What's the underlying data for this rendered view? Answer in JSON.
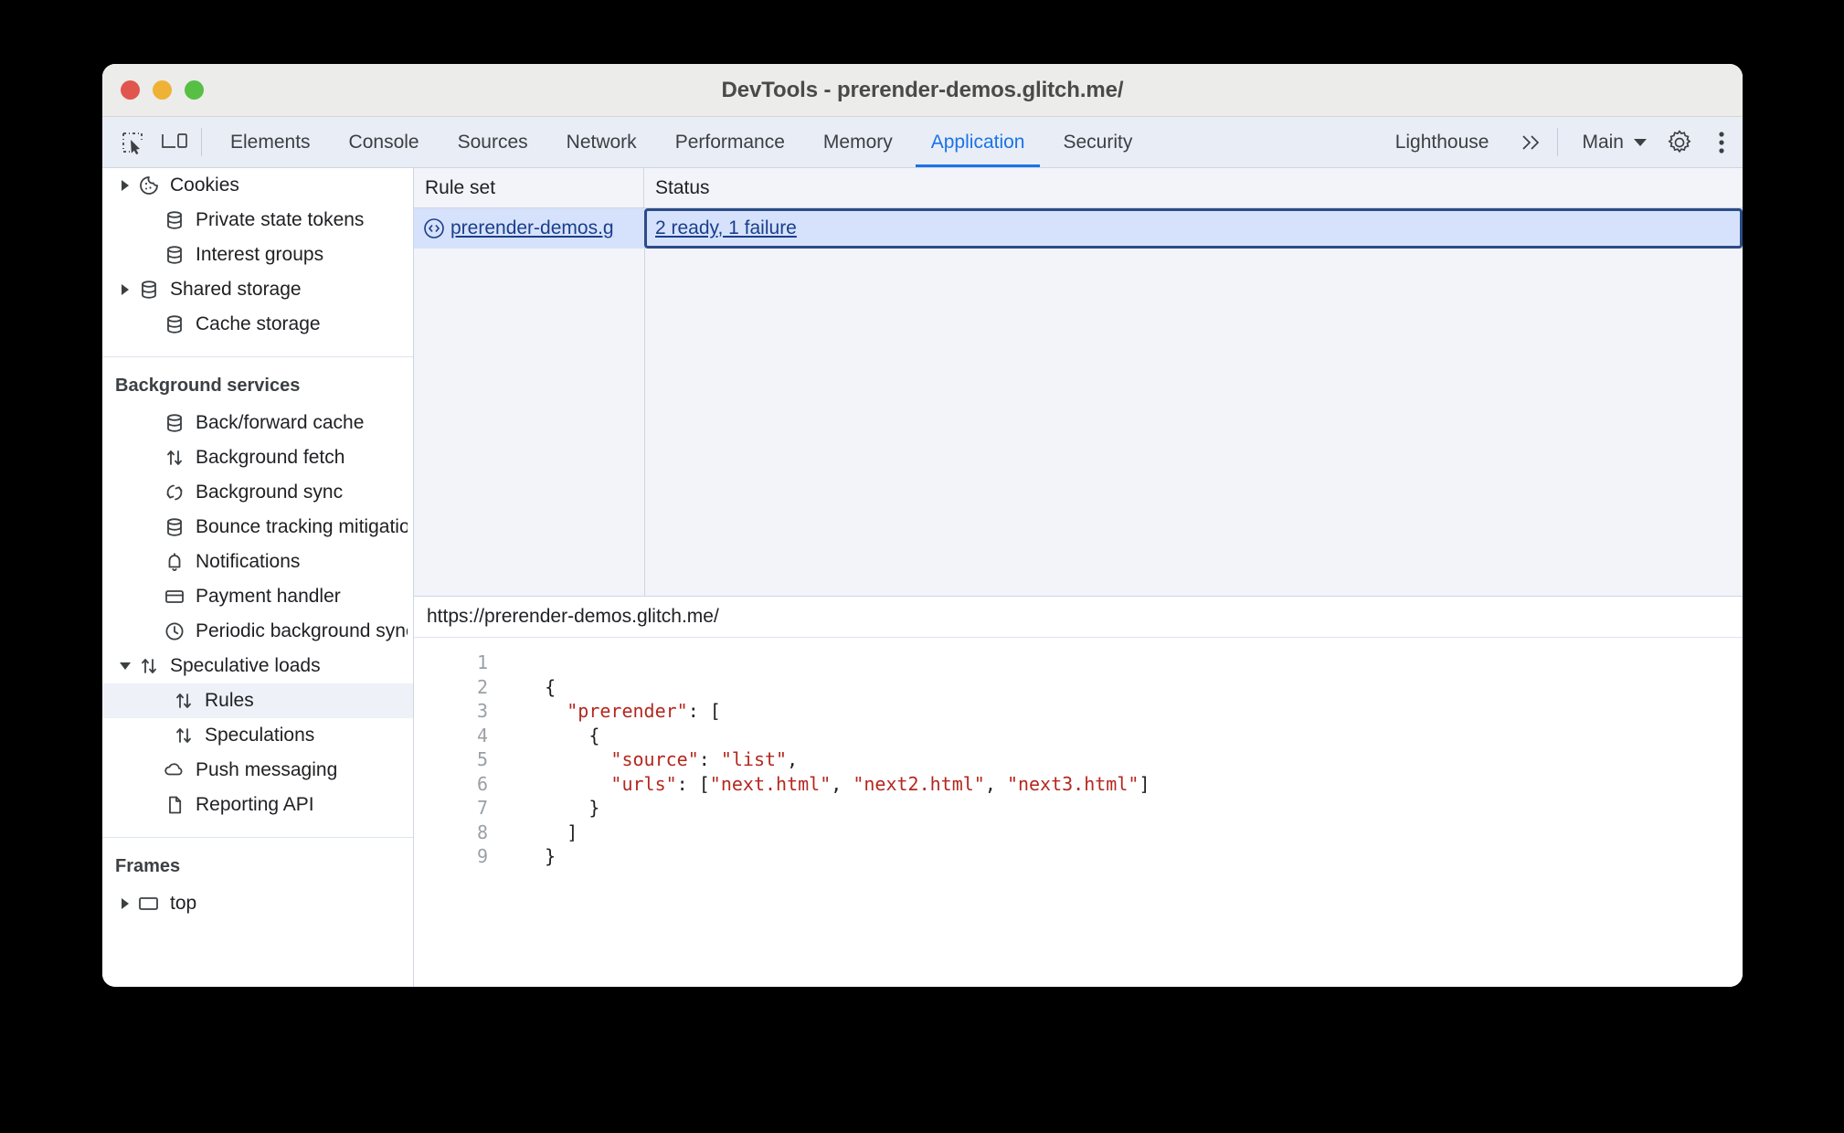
{
  "window": {
    "title": "DevTools - prerender-demos.glitch.me/",
    "traffic_lights": [
      "close",
      "minimize",
      "zoom"
    ]
  },
  "toolbar": {
    "inspect_icon": "inspect-element-icon",
    "device_icon": "device-toolbar-icon",
    "tabs": [
      {
        "label": "Elements",
        "active": false
      },
      {
        "label": "Console",
        "active": false
      },
      {
        "label": "Sources",
        "active": false
      },
      {
        "label": "Network",
        "active": false
      },
      {
        "label": "Performance",
        "active": false
      },
      {
        "label": "Memory",
        "active": false
      },
      {
        "label": "Application",
        "active": true
      },
      {
        "label": "Security",
        "active": false
      },
      {
        "label": "Lighthouse",
        "active": false
      }
    ],
    "more_tabs_label": "≫",
    "context_label": "Main",
    "settings_icon": "gear-icon",
    "more_icon": "kebab-menu-icon",
    "accent_color": "#1a73e8"
  },
  "sidebar": {
    "storage_items": [
      {
        "label": "Cookies",
        "icon": "cookie-icon",
        "arrow": true,
        "indent": 0,
        "selected": false
      },
      {
        "label": "Private state tokens",
        "icon": "database-icon",
        "arrow": false,
        "indent": 1,
        "selected": false
      },
      {
        "label": "Interest groups",
        "icon": "database-icon",
        "arrow": false,
        "indent": 1,
        "selected": false
      },
      {
        "label": "Shared storage",
        "icon": "database-icon",
        "arrow": true,
        "indent": 0,
        "selected": false
      },
      {
        "label": "Cache storage",
        "icon": "database-icon",
        "arrow": false,
        "indent": 1,
        "selected": false
      }
    ],
    "background_services_title": "Background services",
    "background_services_items": [
      {
        "label": "Back/forward cache",
        "icon": "database-icon",
        "arrow": false,
        "indent": 1,
        "selected": false
      },
      {
        "label": "Background fetch",
        "icon": "updown-arrows-icon",
        "arrow": false,
        "indent": 1,
        "selected": false
      },
      {
        "label": "Background sync",
        "icon": "sync-icon",
        "arrow": false,
        "indent": 1,
        "selected": false
      },
      {
        "label": "Bounce tracking mitigations",
        "icon": "database-icon",
        "arrow": false,
        "indent": 1,
        "selected": false
      },
      {
        "label": "Notifications",
        "icon": "bell-icon",
        "arrow": false,
        "indent": 1,
        "selected": false
      },
      {
        "label": "Payment handler",
        "icon": "credit-card-icon",
        "arrow": false,
        "indent": 1,
        "selected": false
      },
      {
        "label": "Periodic background sync",
        "icon": "clock-icon",
        "arrow": false,
        "indent": 1,
        "selected": false
      },
      {
        "label": "Speculative loads",
        "icon": "updown-arrows-icon",
        "arrow": true,
        "expanded": true,
        "indent": 0,
        "selected": false
      },
      {
        "label": "Rules",
        "icon": "updown-arrows-icon",
        "arrow": false,
        "indent": 2,
        "selected": true
      },
      {
        "label": "Speculations",
        "icon": "updown-arrows-icon",
        "arrow": false,
        "indent": 2,
        "selected": false
      },
      {
        "label": "Push messaging",
        "icon": "cloud-icon",
        "arrow": false,
        "indent": 1,
        "selected": false
      },
      {
        "label": "Reporting API",
        "icon": "document-icon",
        "arrow": false,
        "indent": 1,
        "selected": false
      }
    ],
    "frames_title": "Frames",
    "frames_items": [
      {
        "label": "top",
        "icon": "frame-icon",
        "arrow": true,
        "indent": 0,
        "selected": false
      }
    ]
  },
  "main": {
    "columns": [
      {
        "key": "ruleset",
        "label": "Rule set"
      },
      {
        "key": "status",
        "label": "Status"
      }
    ],
    "rows": [
      {
        "ruleset": "prerender-demos.g",
        "ruleset_icon": "code-brackets-icon",
        "status": "2 ready, 1 failure",
        "selected": true
      }
    ],
    "detail_url": "https://prerender-demos.glitch.me/",
    "code_lines": [
      {
        "n": "1",
        "segments": []
      },
      {
        "n": "2",
        "segments": [
          {
            "t": "    {",
            "c": "plain"
          }
        ]
      },
      {
        "n": "3",
        "segments": [
          {
            "t": "      ",
            "c": "plain"
          },
          {
            "t": "\"prerender\"",
            "c": "string"
          },
          {
            "t": ": [",
            "c": "plain"
          }
        ]
      },
      {
        "n": "4",
        "segments": [
          {
            "t": "        {",
            "c": "plain"
          }
        ]
      },
      {
        "n": "5",
        "segments": [
          {
            "t": "          ",
            "c": "plain"
          },
          {
            "t": "\"source\"",
            "c": "string"
          },
          {
            "t": ": ",
            "c": "plain"
          },
          {
            "t": "\"list\"",
            "c": "string"
          },
          {
            "t": ",",
            "c": "plain"
          }
        ]
      },
      {
        "n": "6",
        "segments": [
          {
            "t": "          ",
            "c": "plain"
          },
          {
            "t": "\"urls\"",
            "c": "string"
          },
          {
            "t": ": [",
            "c": "plain"
          },
          {
            "t": "\"next.html\"",
            "c": "string"
          },
          {
            "t": ", ",
            "c": "plain"
          },
          {
            "t": "\"next2.html\"",
            "c": "string"
          },
          {
            "t": ", ",
            "c": "plain"
          },
          {
            "t": "\"next3.html\"",
            "c": "string"
          },
          {
            "t": "]",
            "c": "plain"
          }
        ]
      },
      {
        "n": "7",
        "segments": [
          {
            "t": "        }",
            "c": "plain"
          }
        ]
      },
      {
        "n": "8",
        "segments": [
          {
            "t": "      ]",
            "c": "plain"
          }
        ]
      },
      {
        "n": "9",
        "segments": [
          {
            "t": "    }",
            "c": "plain"
          }
        ]
      }
    ]
  },
  "colors": {
    "selection_bg": "#d6e2fb",
    "focus_ring": "#2b4c86",
    "link": "#1a3e8c",
    "string": "#b5271f",
    "panel_bg": "#f3f4f9"
  }
}
